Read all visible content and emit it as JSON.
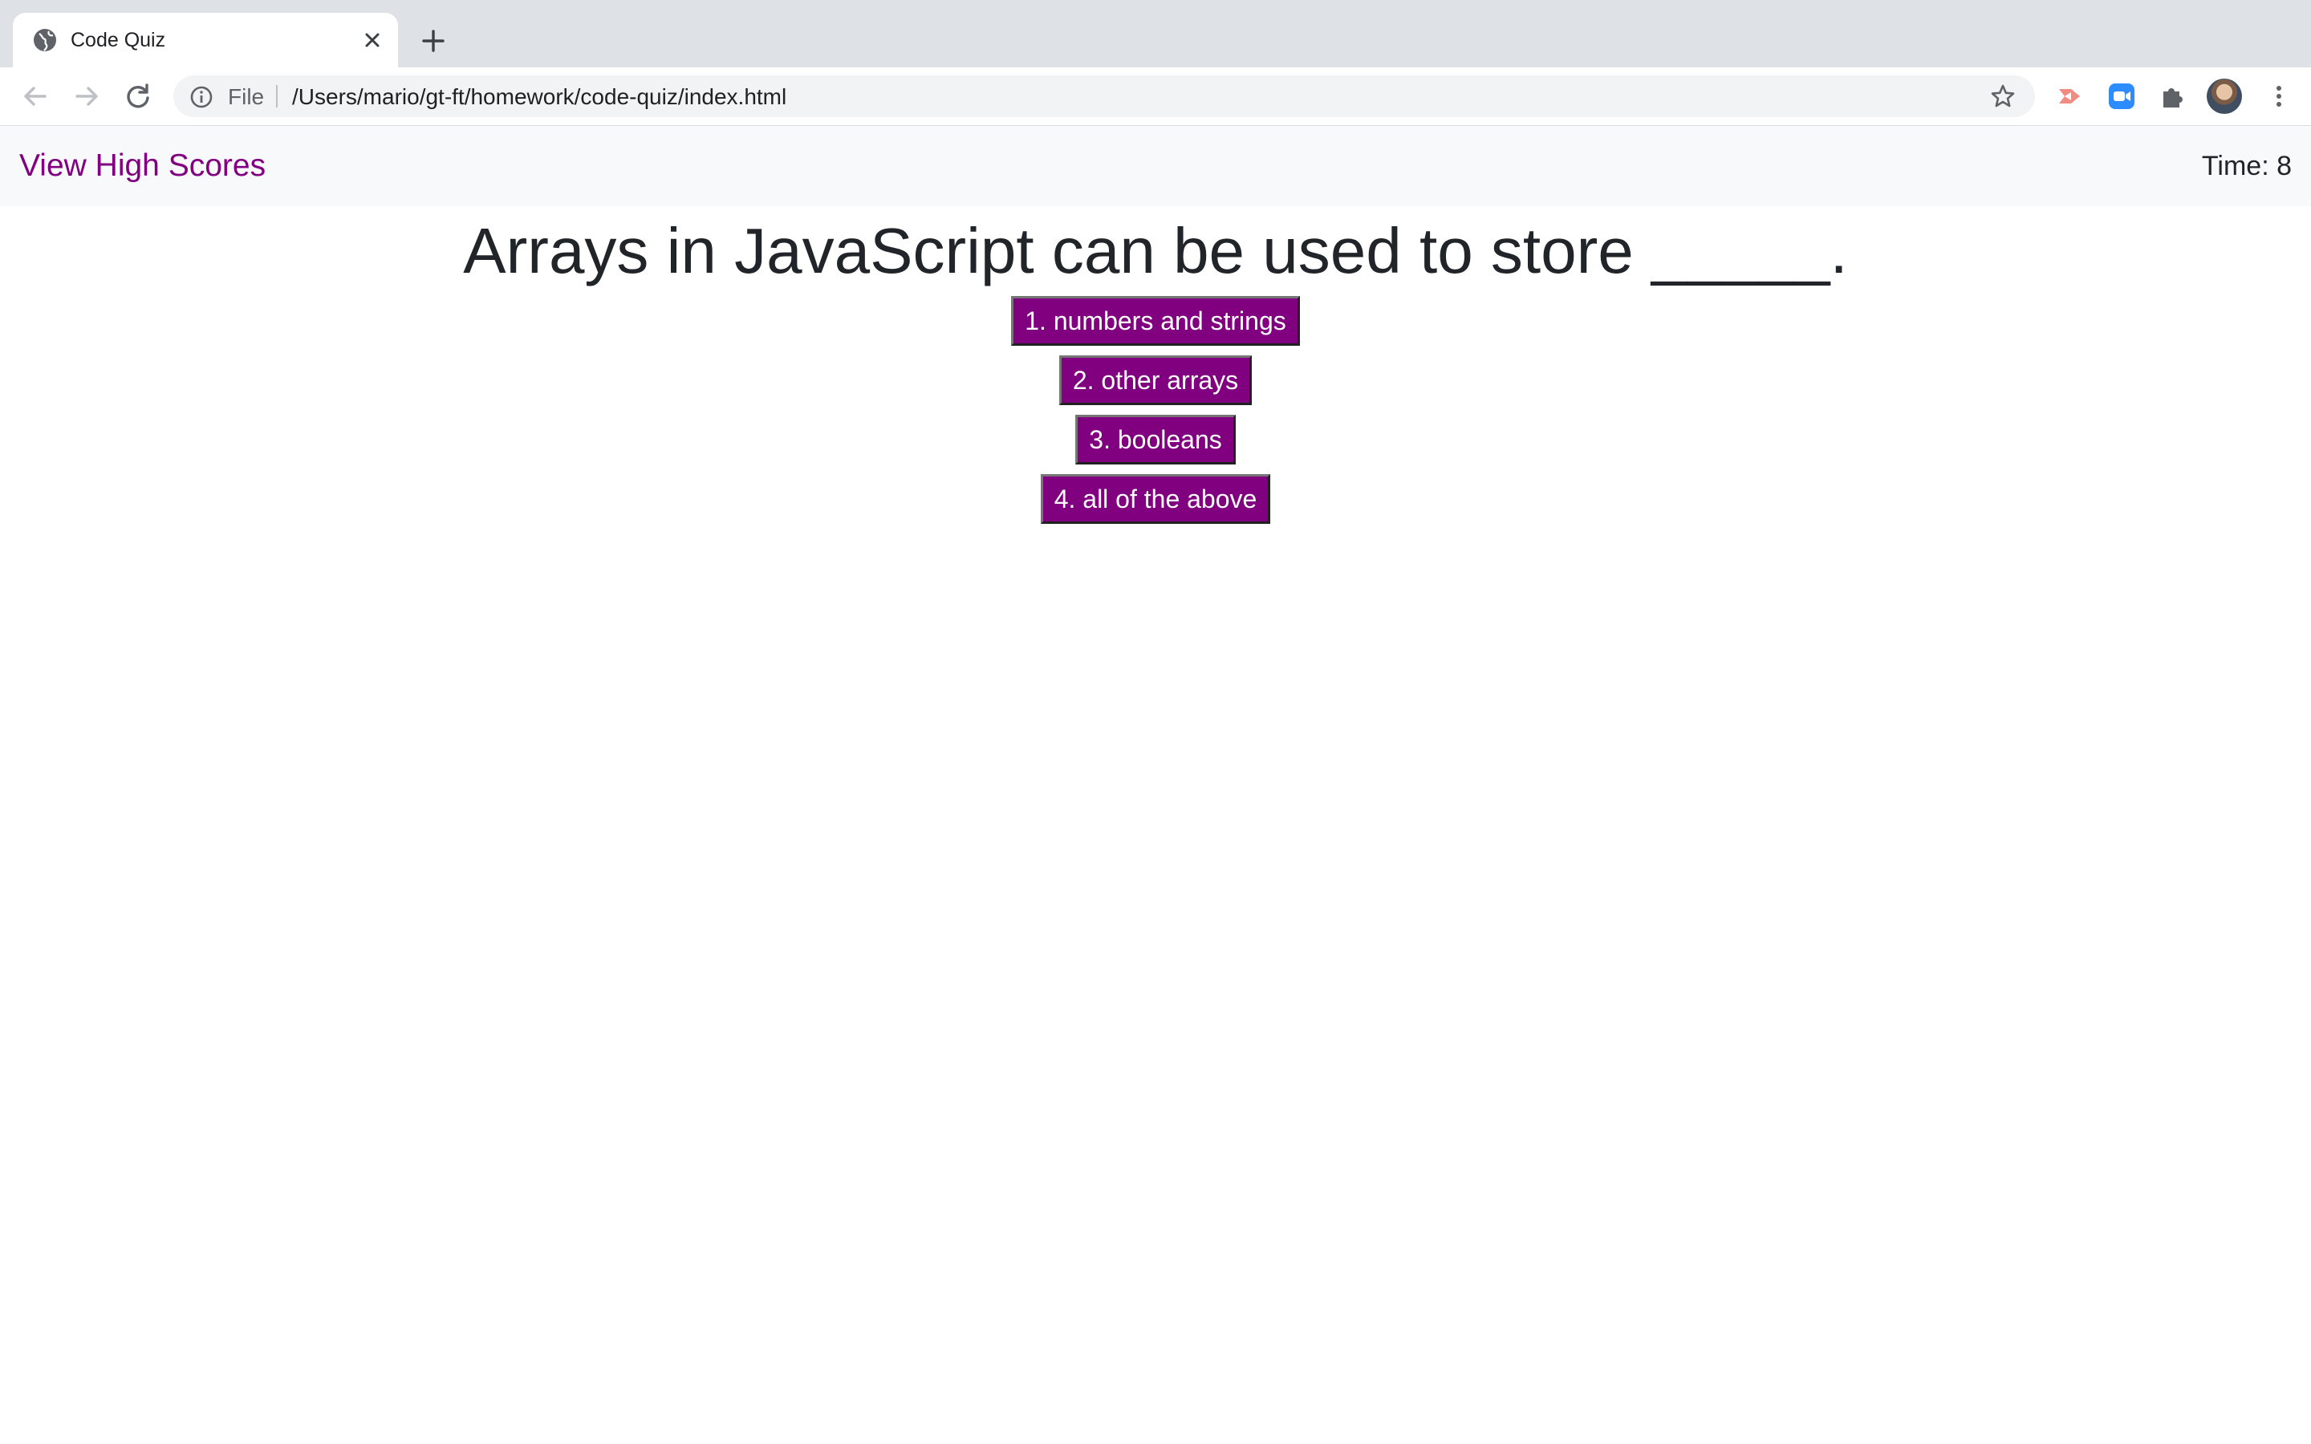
{
  "browser": {
    "tab_title": "Code Quiz",
    "url_scheme": "File",
    "url": "/Users/mario/gt-ft/homework/code-quiz/index.html"
  },
  "header": {
    "high_scores_link": "View High Scores",
    "timer": "Time: 8"
  },
  "quiz": {
    "question": "Arrays in JavaScript can be used to store _____.",
    "choices": [
      "1. numbers and strings",
      "2. other arrays",
      "3. booleans",
      "4. all of the above"
    ]
  },
  "colors": {
    "accent": "#800080",
    "header_bg": "#f8f9fa",
    "tabstrip_bg": "#dee1e6"
  }
}
